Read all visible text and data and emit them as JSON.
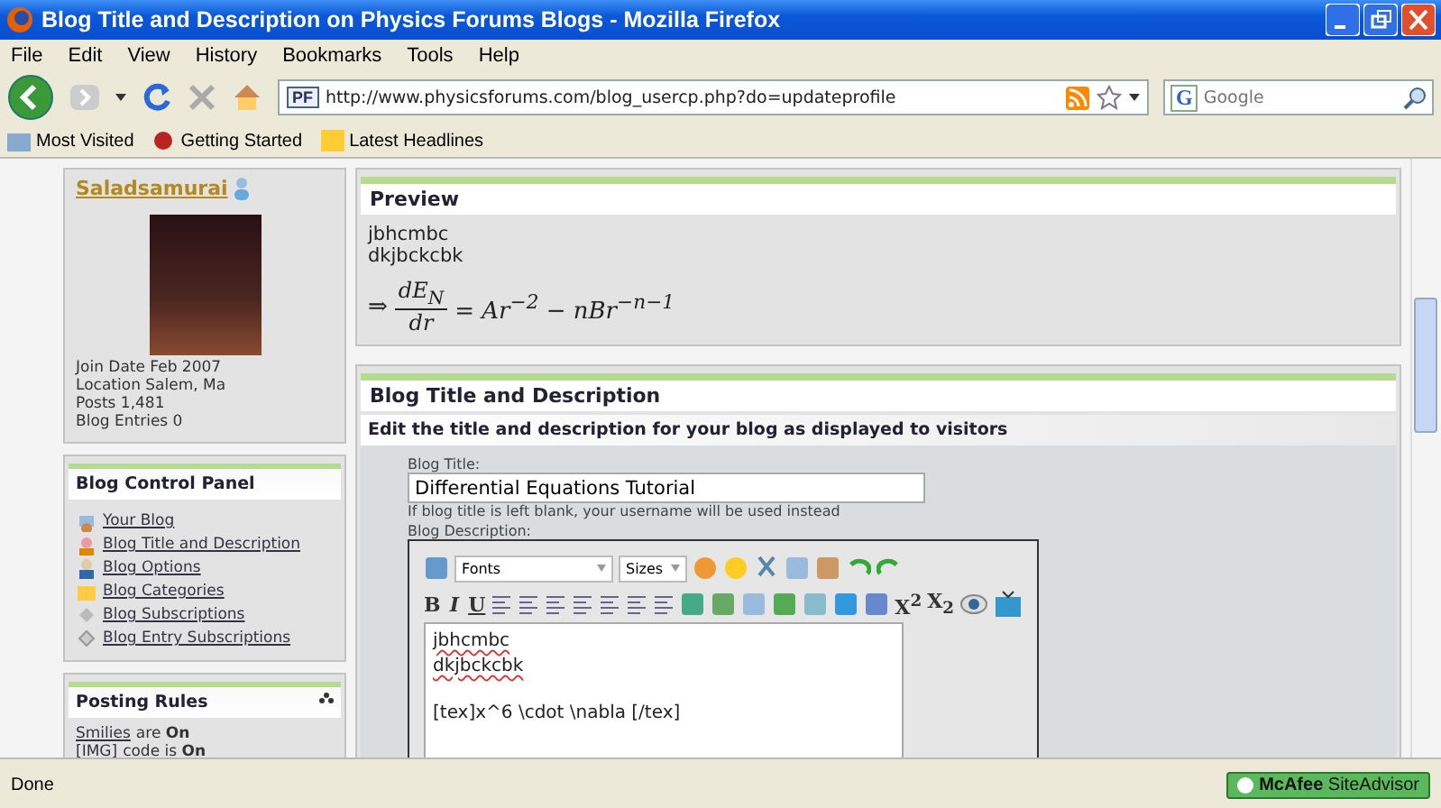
{
  "window": {
    "title": "Blog Title and Description on Physics Forums Blogs - Mozilla Firefox"
  },
  "menu": [
    "File",
    "Edit",
    "View",
    "History",
    "Bookmarks",
    "Tools",
    "Help"
  ],
  "address_bar": {
    "favicon": "PF",
    "url": "http://www.physicsforums.com/blog_usercp.php?do=updateprofile"
  },
  "search": {
    "engine": "G",
    "placeholder": "Google"
  },
  "bookmarks": [
    "Most Visited",
    "Getting Started",
    "Latest Headlines"
  ],
  "profile": {
    "username": "Saladsamurai",
    "stats": [
      "Join Date Feb 2007",
      "Location Salem, Ma",
      "Posts 1,481",
      "Blog Entries 0"
    ]
  },
  "control_panel": {
    "title": "Blog Control Panel",
    "links": [
      "Your Blog",
      "Blog Title and Description",
      "Blog Options",
      "Blog Categories",
      "Blog Subscriptions",
      "Blog Entry Subscriptions"
    ]
  },
  "posting_rules": {
    "title": "Posting Rules",
    "rules": [
      {
        "link": "Smilies",
        "text": "are **On**"
      },
      {
        "link": "[IMG]",
        "text": "code is **On**"
      }
    ]
  },
  "preview": {
    "title": "Preview",
    "lines": [
      "jbhcmbc",
      "dkjbckcbk"
    ],
    "formula": {
      "arrow": "⇒",
      "numerator": "dE$_{N}$",
      "denominator": "dr",
      "rhs": "= Ar$^{−2}$ − nBr$^{−n−1}$"
    }
  },
  "blog_form": {
    "title": "Blog Title and Description",
    "subtitle": "Edit the title and description for your blog as displayed to visitors",
    "title_label": "Blog Title:",
    "title_value": "Differential Equations Tutorial",
    "title_hint": "If blog title is left blank, your username will be used instead",
    "description_label": "Blog Description:",
    "editor": {
      "font_select": "Fonts",
      "size_select": "Sizes",
      "format_buttons": [
        "B",
        "I",
        "U"
      ],
      "script_buttons": [
        "X$^{2}$",
        "X$_{2}$"
      ],
      "lines": [
        {
          "text": "jbhcmbc",
          "misspelled": true
        },
        {
          "text": "dkjbckcbk",
          "misspelled": true
        },
        {
          "text": "[tex]x^6 \\cdot \\nabla [/tex]",
          "misspelled": false
        }
      ]
    }
  },
  "status_bar": {
    "text": "Done",
    "addon": "**McAfee** SiteAdvisor"
  }
}
